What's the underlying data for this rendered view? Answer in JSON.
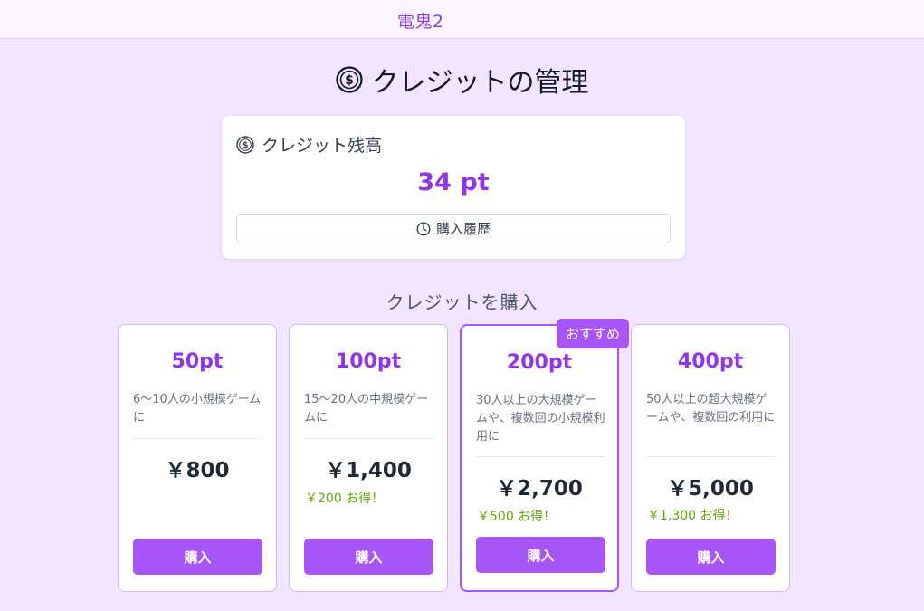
{
  "header": {
    "brand": "電鬼2"
  },
  "page": {
    "title": "クレジットの管理",
    "title_icon": "coin-dollar-icon"
  },
  "balance": {
    "label": "クレジット残高",
    "icon": "coin-dollar-icon",
    "amount": "34 pt",
    "history_button": "購入履歴",
    "history_icon": "clock-icon"
  },
  "purchase": {
    "title": "クレジットを購入",
    "plans": [
      {
        "points": "50pt",
        "desc": "6〜10人の小規模ゲームに",
        "price": "￥800",
        "saving": "",
        "buy": "購入"
      },
      {
        "points": "100pt",
        "desc": "15〜20人の中規模ゲームに",
        "price": "￥1,400",
        "saving": "￥200 お得！",
        "buy": "購入"
      },
      {
        "points": "200pt",
        "desc": "30人以上の大規模ゲームや、複数回の小規模利用に",
        "price": "￥2,700",
        "saving": "￥500 お得！",
        "buy": "購入",
        "badge": "おすすめ"
      },
      {
        "points": "400pt",
        "desc": "50人以上の超大規模ゲームや、複数回の利用に",
        "price": "￥5,000",
        "saving": "￥1,300 お得！",
        "buy": "購入"
      }
    ]
  },
  "colors": {
    "accent": "#a855f7",
    "accent_text": "#9333ea",
    "saving": "#65a30d",
    "background": "#f3e4ff"
  }
}
